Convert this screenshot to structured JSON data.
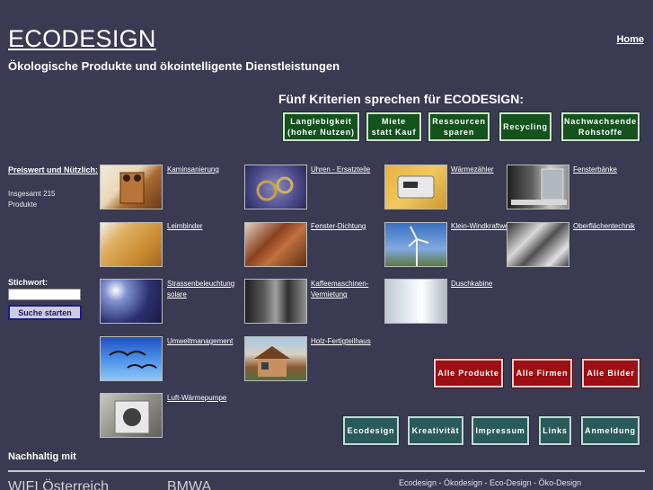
{
  "header": {
    "title": "ECODESIGN",
    "home_label": "Home",
    "tagline": "Ökologische Produkte und ökointelligente Dienstleistungen"
  },
  "criteria": {
    "title": "Fünf Kriterien sprechen für ECODESIGN:",
    "buttons": [
      "Langlebigkeit\n(hoher Nutzen)",
      "Miete\nstatt Kauf",
      "Ressourcen\nsparen",
      "Recycling",
      "Nachwachsende\nRohstoffe"
    ]
  },
  "sidebar": {
    "heading": "Preiswert und Nützlich:",
    "count_text": "Insgesamt 215 Produkte",
    "search_label": "Stichwort:",
    "search_value": "",
    "search_button": "Suche starten"
  },
  "products": [
    {
      "label": "Kaminsanierung",
      "icon": "chimney-image"
    },
    {
      "label": "Uhren - Ersatzteile",
      "icon": "clock-gears-image"
    },
    {
      "label": "Wärmezähler",
      "icon": "heat-meter-image"
    },
    {
      "label": "Fensterbänke",
      "icon": "window-sill-image"
    },
    {
      "label": "Leimbinder",
      "icon": "glulam-beam-image"
    },
    {
      "label": "Fenster-Dichtung",
      "icon": "window-seal-image"
    },
    {
      "label": "Klein-Windkraftwerk",
      "icon": "wind-turbine-image"
    },
    {
      "label": "Oberflächentechnik",
      "icon": "surface-tech-image"
    },
    {
      "label": "Strassenbeleuchtung solare",
      "icon": "solar-streetlight-image"
    },
    {
      "label": "Kaffeemaschinen-Vermietung",
      "icon": "coffee-machine-image"
    },
    {
      "label": "Duschkabine",
      "icon": "shower-cabin-image"
    },
    {
      "label": "Umweltmanagement",
      "icon": "birds-sky-image"
    },
    {
      "label": "Holz-Fertigteilhaus",
      "icon": "wooden-house-image"
    },
    {
      "label": "Luft-Wärmepumpe",
      "icon": "heat-pump-image"
    }
  ],
  "actions": {
    "red": [
      "Alle Produkte",
      "Alle Firmen",
      "Alle Bilder"
    ],
    "teal": [
      "Ecodesign",
      "Kreativität",
      "Impressum",
      "Links",
      "Anmeldung"
    ]
  },
  "footer": {
    "nachhaltig": "Nachhaltig mit",
    "left": "WIFI Österreich",
    "mid": "BMWA",
    "keywords": "Ecodesign - Ökodesign - Eco-Design - Öko-Design"
  },
  "colors": {
    "background": "#3a3a52",
    "criteria_green": "#14521e",
    "action_red": "#9c0f14",
    "nav_teal": "#2b5a5a"
  }
}
